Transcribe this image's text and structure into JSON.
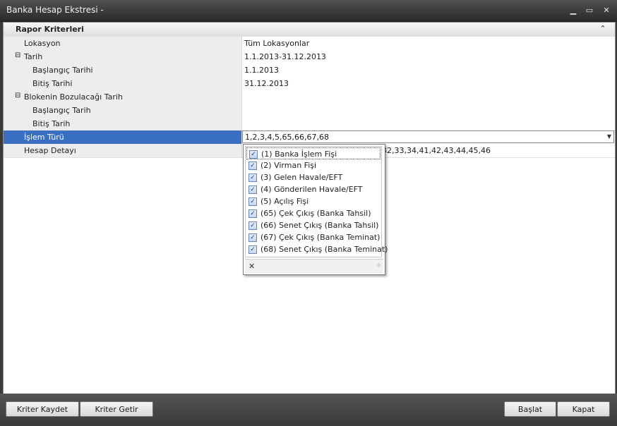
{
  "window": {
    "title": "Banka Hesap Ekstresi -",
    "minimize_glyph": "▁",
    "maximize_glyph": "▭",
    "close_glyph": "✕"
  },
  "group": {
    "title": "Rapor Kriterleri",
    "collapse_glyph": "⌃"
  },
  "rows": [
    {
      "label": "Lokasyon",
      "value": "Tüm Lokasyonlar"
    },
    {
      "label": "Tarih",
      "value": "1.1.2013-31.12.2013",
      "expander": "⊟"
    },
    {
      "label": "Başlangıç Tarihi",
      "value": "1.1.2013"
    },
    {
      "label": "Bitiş Tarihi",
      "value": "31.12.2013"
    },
    {
      "label": "Blokenin Bozulacağı Tarih",
      "value": "",
      "expander": "⊟"
    },
    {
      "label": "Başlangıç Tarih",
      "value": ""
    },
    {
      "label": "Bitiş Tarih",
      "value": ""
    },
    {
      "label": "İşlem Türü",
      "value": "1,2,3,4,5,65,66,67,68"
    },
    {
      "label": "Hesap Detayı",
      "value": "32,33,34,41,42,43,44,45,46"
    }
  ],
  "dropdown": {
    "arrow_glyph": "▼",
    "check_glyph": "✓",
    "close_glyph": "✕",
    "grip_glyph": "⁘",
    "items": [
      {
        "label": "(1) Banka İşlem Fişi",
        "checked": true
      },
      {
        "label": "(2) Virman Fişi",
        "checked": true
      },
      {
        "label": "(3) Gelen Havale/EFT",
        "checked": true
      },
      {
        "label": "(4) Gönderilen Havale/EFT",
        "checked": true
      },
      {
        "label": "(5) Açılış Fişi",
        "checked": true
      },
      {
        "label": "(65) Çek Çıkış (Banka Tahsil)",
        "checked": true
      },
      {
        "label": "(66) Senet Çıkış (Banka Tahsil)",
        "checked": true
      },
      {
        "label": "(67) Çek Çıkış (Banka Teminat)",
        "checked": true
      },
      {
        "label": "(68) Senet Çıkış (Banka Teminat)",
        "checked": true
      }
    ]
  },
  "buttons": {
    "save_criteria": "Kriter Kaydet",
    "load_criteria": "Kriter Getir",
    "start": "Başlat",
    "close": "Kapat"
  }
}
